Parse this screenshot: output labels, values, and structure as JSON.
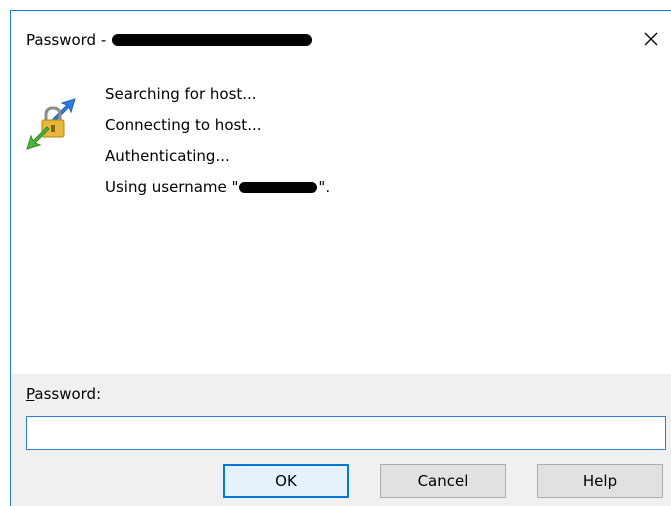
{
  "window": {
    "title": "Password - ",
    "close_symbol": "✕",
    "close_icon": "close-icon"
  },
  "content": {
    "icon": "key-exchange-icon",
    "status_lines": [
      "Searching for host...",
      "Connecting to host...",
      "Authenticating...",
      "Using username \""
    ],
    "username_suffix": "\"."
  },
  "form": {
    "password_label_mnemonic": "P",
    "password_label_rest": "assword:",
    "password_value": "",
    "password_placeholder": ""
  },
  "buttons": {
    "ok": "OK",
    "cancel": "Cancel",
    "help": "Help"
  },
  "colors": {
    "accent": "#0078d7",
    "border": "#1e7bd7",
    "panel": "#f0f0f0"
  }
}
